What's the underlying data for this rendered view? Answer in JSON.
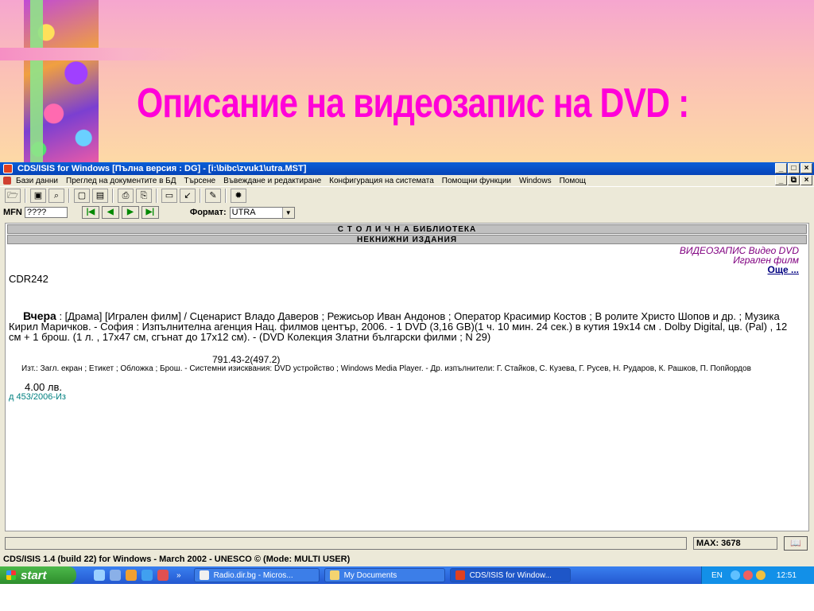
{
  "slide": {
    "title": "Описание на видеозапис на DVD :"
  },
  "window": {
    "title": "CDS/ISIS for Windows [Пълна версия : DG] - [i:\\bibc\\zvuk1\\utra.MST]",
    "controls": {
      "minimize": "_",
      "maximize": "□",
      "close": "×",
      "restore": "⧉"
    }
  },
  "menu": {
    "items": [
      "Бази данни",
      "Преглед на документите в БД",
      "Търсене",
      "Въвеждане и редактиране",
      "Конфигурация на системата",
      "Помощни функции",
      "Windows",
      "Помощ"
    ]
  },
  "toolbar": {
    "buttons": [
      "open-folder",
      "save",
      "binoculars",
      "document",
      "documents",
      "zoom-page",
      "print",
      "form",
      "edit-arrow",
      "pencil",
      "lightbulb"
    ],
    "icons": [
      "🗁",
      "▣",
      "⌕",
      "▢",
      "▤",
      "⎙",
      "⎘",
      "▭",
      "↙",
      "✎",
      "✹"
    ]
  },
  "record_nav": {
    "mfn_label": "MFN",
    "mfn_value": "????",
    "nav_icons": [
      "|◀",
      "◀",
      "▶",
      "▶|"
    ],
    "format_label": "Формат:",
    "format_value": "UTRA",
    "dropdown_icon": "▼"
  },
  "record": {
    "banner1": "С Т О Л И Ч Н А  БИБЛИОТЕКА",
    "banner2": "НЕКНИЖНИ   ИЗДАНИЯ",
    "type_line1": "ВИДЕОЗАПИС Видео DVD",
    "type_line2": "Игрален филм",
    "more_link": "Още ...",
    "call_number": "CDR242",
    "title": "Вчера",
    "description": " : [Драма]  [Игрален филм] / Сценарист Владо Даверов ; Режисьор Иван Андонов ; Оператор Красимир Костов ; В ролите Христо Шопов и др. ; Музика Кирил Маричков. - София : Изпълнителна агенция Нац. филмов център, 2006. - 1 DVD (3,16 GB)(1 ч. 10 мин. 24 сек.) в кутия 19x14 см . Dolby Digital, цв. (Pal) , 12 см + 1 брош. (1 л. , 17x47 см, сгънат до 17x12 см). - (DVD Колекция Златни български филми ; N 29)",
    "classification": "791.43-2(497.2)",
    "notes": "Изт.: Загл. екран ; Етикет ; Обложка ; Брош. - Системни изисквания: DVD устройство ; Windows Media Player. - Др. изпълнители: Г. Стайков, С. Кузева, Г. Русев, Н. Рударов, К. Рашков, П. Попйордов",
    "price": "4.00 лв.",
    "inventory": "д 453/2006-Из"
  },
  "status": {
    "max_label": "MAX: 3678",
    "book_icon": "📖",
    "info": "CDS/ISIS 1.4 (build 22) for Windows - March 2002 - UNESCO ©  (Mode: MULTI USER)"
  },
  "taskbar": {
    "start_label": "start",
    "overflow": "»",
    "tasks": [
      "Radio.dir.bg - Micros...",
      "My Documents",
      "CDS/ISIS for Window..."
    ],
    "tray_lang": "EN",
    "clock": "12:51"
  },
  "colors": {
    "title_pink": "#ff00d8",
    "titlebar_blue": "#0a5fd8",
    "taskbar_blue": "#2458d0",
    "start_green": "#3aa238"
  }
}
